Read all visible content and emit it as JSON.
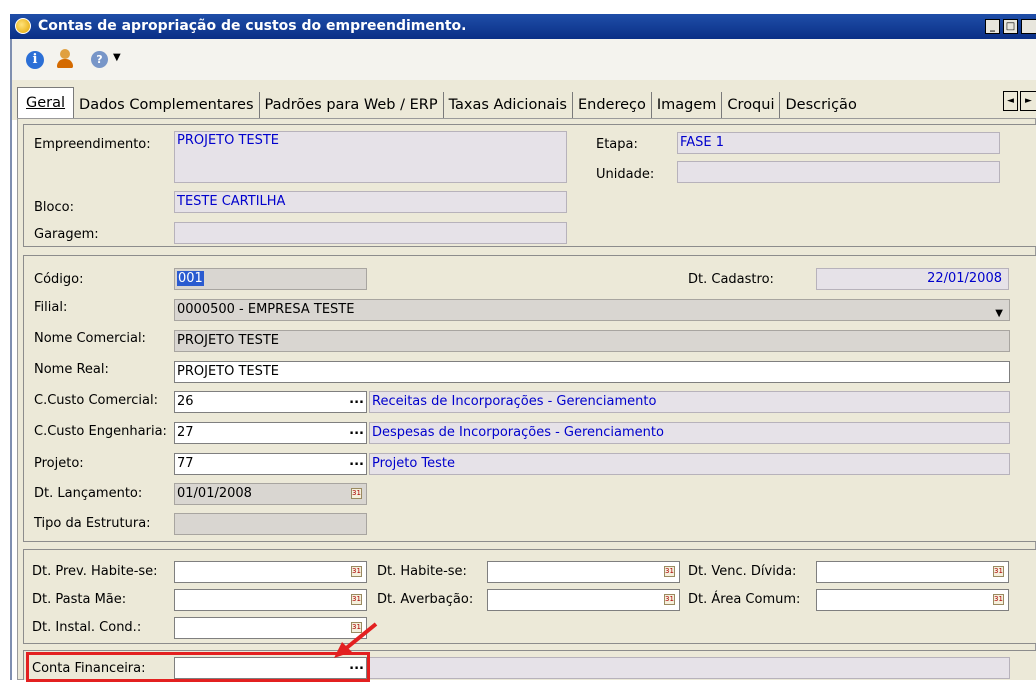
{
  "window": {
    "title": "Contas de apropriação de custos do empreendimento.",
    "controls": [
      "_",
      "□"
    ]
  },
  "toolbar": {
    "icons": [
      "info-icon",
      "user-icon",
      "help-icon",
      "dropdown-arrow-icon"
    ],
    "info_glyph": "i",
    "help_glyph": "?",
    "arrow_glyph": "▼"
  },
  "tabs": [
    "Geral",
    "Dados Complementares",
    "Padrões para Web / ERP",
    "Taxas Adicionais",
    "Endereço",
    "Imagem",
    "Croqui",
    "Descrição"
  ],
  "tab_scroll": {
    "left": "◄",
    "right": "►"
  },
  "header_panel": {
    "empreendimento_label": "Empreendimento:",
    "empreendimento_value": "PROJETO TESTE",
    "etapa_label": "Etapa:",
    "etapa_value": "FASE 1",
    "unidade_label": "Unidade:",
    "unidade_value": "",
    "bloco_label": "Bloco:",
    "bloco_value": "TESTE CARTILHA",
    "garagem_label": "Garagem:",
    "garagem_value": ""
  },
  "main_panel": {
    "codigo_label": "Código:",
    "codigo_value": "001",
    "dt_cadastro_label": "Dt. Cadastro:",
    "dt_cadastro_value": "22/01/2008",
    "filial_label": "Filial:",
    "filial_value": "0000500 - EMPRESA TESTE",
    "nome_comercial_label": "Nome Comercial:",
    "nome_comercial_value": "PROJETO TESTE",
    "nome_real_label": "Nome Real:",
    "nome_real_value": "PROJETO TESTE",
    "ccusto_comercial_label": "C.Custo Comercial:",
    "ccusto_comercial_value": "26",
    "ccusto_comercial_desc": "Receitas de Incorporações - Gerenciamento",
    "ccusto_engenharia_label": "C.Custo Engenharia:",
    "ccusto_engenharia_value": "27",
    "ccusto_engenharia_desc": "Despesas de Incorporações - Gerenciamento",
    "projeto_label": "Projeto:",
    "projeto_value": "77",
    "projeto_desc": "Projeto Teste",
    "dt_lancamento_label": "Dt. Lançamento:",
    "dt_lancamento_value": "01/01/2008",
    "tipo_estrutura_label": "Tipo da Estrutura:",
    "tipo_estrutura_value": ""
  },
  "dates_panel": {
    "prev_habite_label": "Dt. Prev. Habite-se:",
    "habite_label": "Dt. Habite-se:",
    "venc_divida_label": "Dt. Venc. Dívida:",
    "pasta_mae_label": "Dt. Pasta Mãe:",
    "averbacao_label": "Dt. Averbação:",
    "area_comum_label": "Dt. Área Comum:",
    "instal_cond_label": "Dt. Instal. Cond.:"
  },
  "bottom_panel": {
    "conta_financeira_label": "Conta Financeira:",
    "conta_financeira_value": ""
  },
  "glyphs": {
    "ellipsis": "...",
    "calendar": "31",
    "dropdown": "▼"
  },
  "colors": {
    "title_bar": "#0a2f86",
    "link_text": "#0000cc",
    "highlight": "#e32020"
  }
}
